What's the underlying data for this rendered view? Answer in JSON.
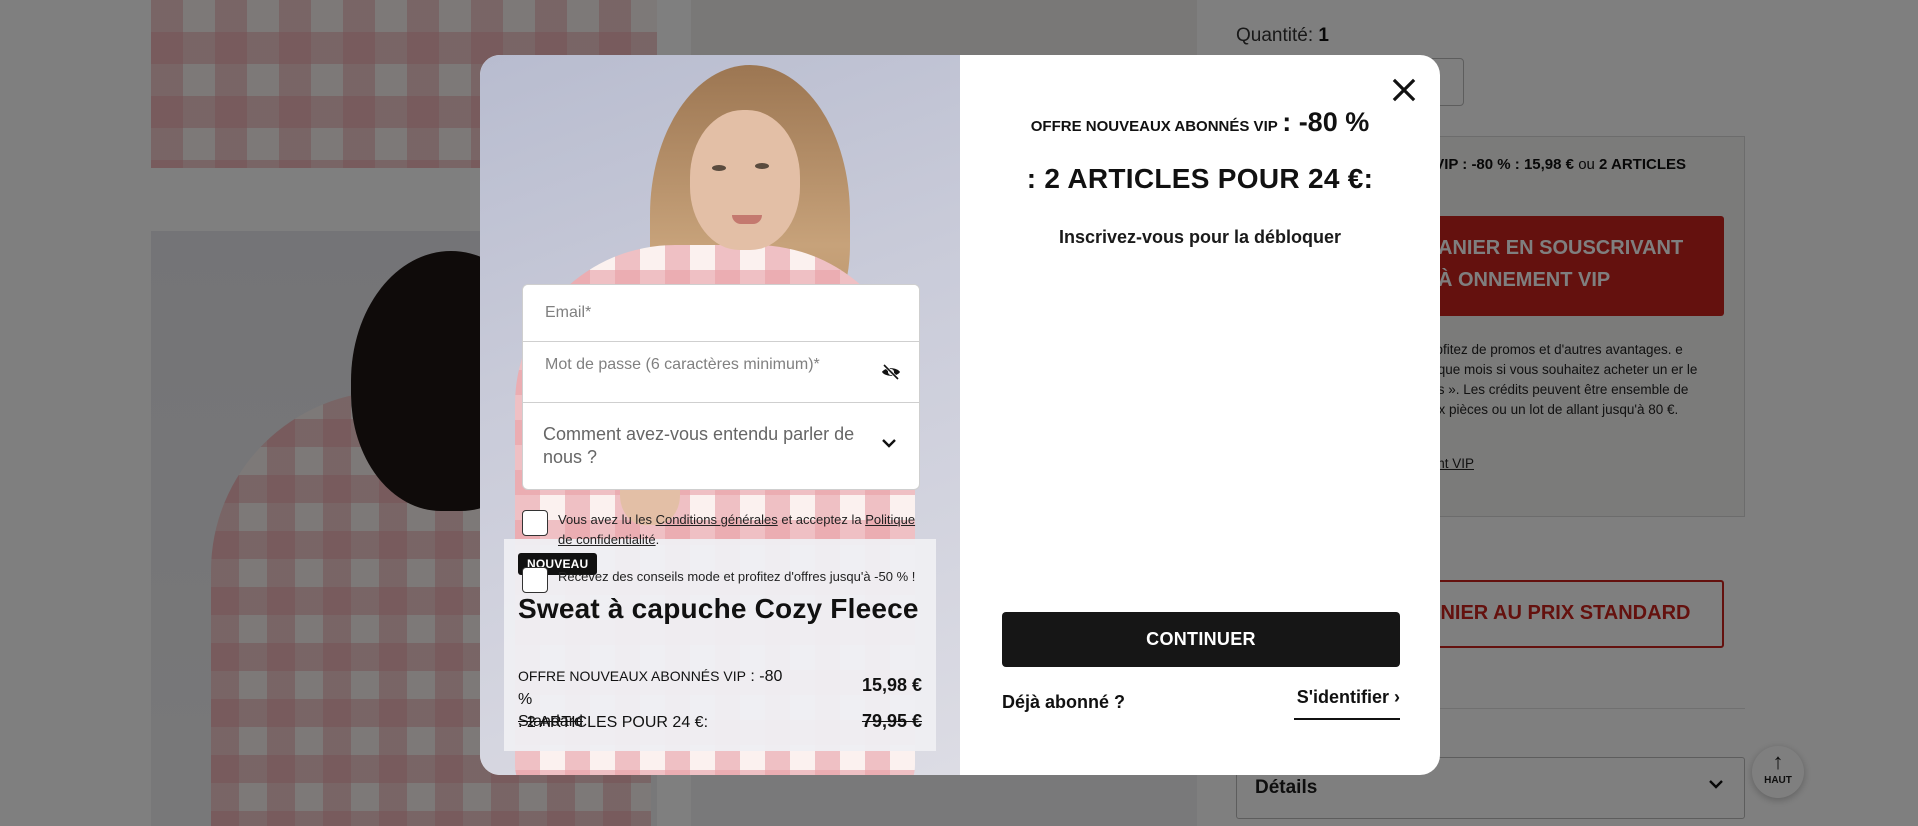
{
  "page": {
    "quantity_label": "Quantité:",
    "quantity_value": "1",
    "vip_offer_line": {
      "prefix": "VIP : -80 %  : 15,98 €",
      "or": "ou",
      "suffix": "2 ARTICLES"
    },
    "vip_cart_button": "ANIER EN SOUSCRIVANT À ONNEMENT VIP",
    "vip_description": ", profitez de promos et d'autres avantages. e chaque mois si vous souhaitez acheter un er le mois ». Les crédits peuvent être ensemble de deux pièces ou un lot de allant jusqu'à 80 €.",
    "vip_link": "nt VIP",
    "standard_cart_button": "ANIER AU PRIX STANDARD",
    "details_label": "Détails",
    "back_to_top_label": "HAUT"
  },
  "modal": {
    "headline_small": "OFFRE NOUVEAUX ABONNÉS VIP",
    "headline_large": ": -80 %",
    "headline2": ": 2 ARTICLES POUR 24 €:",
    "subline": "Inscrivez-vous pour la débloquer",
    "product": {
      "badge": "NOUVEAU",
      "name": "Sweat à capuche Cozy Fleece",
      "offer_small": "OFFRE NOUVEAUX ABONNÉS VIP",
      "offer_rest": ": -80 %",
      "offer_line2": ": 2 ARTICLES POUR 24 €:",
      "vip_price": "15,98 €",
      "standard_label": "Standard",
      "standard_price": "79,95 €"
    },
    "form": {
      "email_placeholder": "Email*",
      "password_placeholder": "Mot de passe (6 caractères minimum)*",
      "source_select": "Comment avez-vous entendu parler de nous ?",
      "terms": {
        "prefix": "Vous avez lu les",
        "terms_link": "Conditions générales",
        "middle": "et acceptez la",
        "privacy_link": "Politique de confidentialité",
        "suffix": "."
      },
      "newsletter": "Recevez des conseils mode et profitez d'offres jusqu'à -50 % !",
      "continue_label": "CONTINUER",
      "already_member": "Déjà abonné ?",
      "login_label": "S'identifier"
    }
  }
}
